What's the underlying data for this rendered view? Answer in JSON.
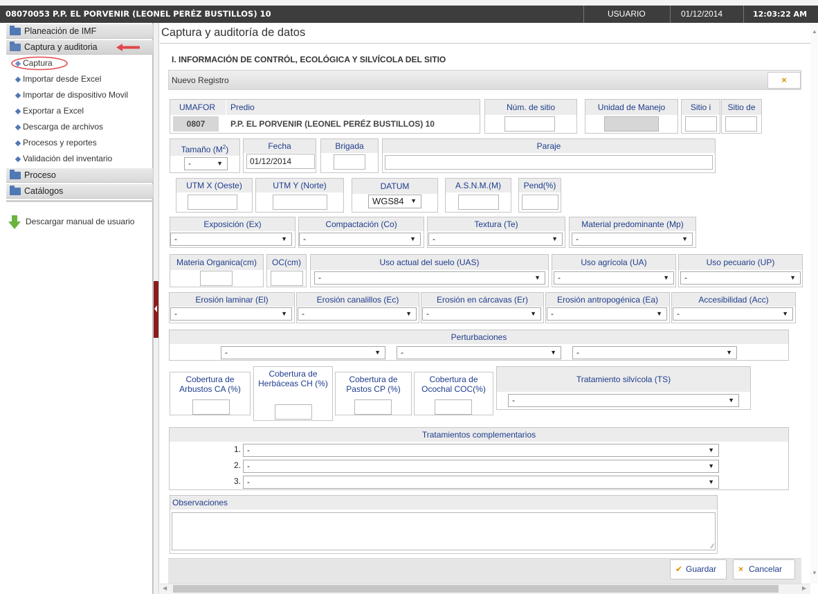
{
  "topbar": {
    "title": "08070053 P.P. EL PORVENIR (LEONEL PERÉZ BUSTILLOS) 10",
    "user": "USUARIO",
    "date": "01/12/2014",
    "time": "12:03:22 AM"
  },
  "sidebar": {
    "groups": [
      {
        "label": "Planeación de IMF"
      },
      {
        "label": "Captura y auditoria"
      },
      {
        "label": "Proceso"
      },
      {
        "label": "Catálogos"
      }
    ],
    "items": [
      {
        "label": "Captura"
      },
      {
        "label": "Importar desde Excel"
      },
      {
        "label": "Importar de dispositivo Movil"
      },
      {
        "label": "Exportar a Excel"
      },
      {
        "label": "Descarga de archivos"
      },
      {
        "label": "Procesos y reportes"
      },
      {
        "label": "Validación del inventario"
      }
    ],
    "download_manual": "Descargar manual de usuario"
  },
  "page": {
    "title": "Captura y auditoría de datos",
    "section_title": "I. INFORMACIÓN DE CONTRÓL, ECOLÓGICA Y SILVÍCOLA DEL SITIO",
    "nuevo_registro": "Nuevo Registro",
    "close": "×"
  },
  "form": {
    "umafor_label": "UMAFOR",
    "umafor_value": "0807",
    "predio_label": "Predio",
    "predio_value": "P.P. EL PORVENIR (LEONEL PERÉZ BUSTILLOS) 10",
    "num_sitio_label": "Núm. de sitio",
    "unidad_manejo_label": "Unidad de Manejo",
    "sitio_i_label": "Sitio i",
    "sitio_de_label": "Sitio de",
    "tamano_label": "Tamaño (M",
    "tamano_sup": "2",
    "tamano_label_end": ")",
    "tamano_value": "-",
    "fecha_label": "Fecha",
    "fecha_value": "01/12/2014",
    "brigada_label": "Brigada",
    "paraje_label": "Paraje",
    "utmx_label": "UTM X (Oeste)",
    "utmy_label": "UTM Y (Norte)",
    "datum_label": "DATUM",
    "datum_value": "WGS84",
    "asnm_label": "A.S.N.M.(M)",
    "pend_label": "Pend(%)",
    "exposicion_label": "Exposición (Ex)",
    "compactacion_label": "Compactación (Co)",
    "textura_label": "Textura (Te)",
    "material_label": "Material predominante (Mp)",
    "materia_org_label": "Materia Organica(cm)",
    "oc_label": "OC(cm)",
    "uso_suelo_label": "Uso actual del suelo (UAS)",
    "uso_agricola_label": "Uso agrícola (UA)",
    "uso_pecuario_label": "Uso pecuario (UP)",
    "erosion_laminar_label": "Erosión laminar (El)",
    "erosion_canalillos_label": "Erosión canalillos (Ec)",
    "erosion_carcavas_label": "Erosión en cárcavas (Er)",
    "erosion_antro_label": "Erosión antropogénica (Ea)",
    "accesibilidad_label": "Accesibilidad (Acc)",
    "perturbaciones_label": "Perturbaciones",
    "cob_arbustos_label": "Cobertura de Arbustos CA (%)",
    "cob_herbaceas_label": "Cobertura de Herbáceas CH (%)",
    "cob_pastos_label": "Cobertura de Pastos CP (%)",
    "cob_ocochal_label": "Cobertura de Ocochal COC(%)",
    "tratamiento_label": "Tratamiento silvícola (TS)",
    "trat_comp_label": "Tratamientos complementarios",
    "trat_nums": [
      "1.",
      "2.",
      "3."
    ],
    "observaciones_label": "Observaciones",
    "select_default": "-"
  },
  "footer": {
    "save": "Guardar",
    "cancel": "Cancelar"
  },
  "colors": {
    "topbar": "#3d3d3d",
    "accent_blue": "#1e3c8c",
    "annotation_red": "#e0474c"
  }
}
